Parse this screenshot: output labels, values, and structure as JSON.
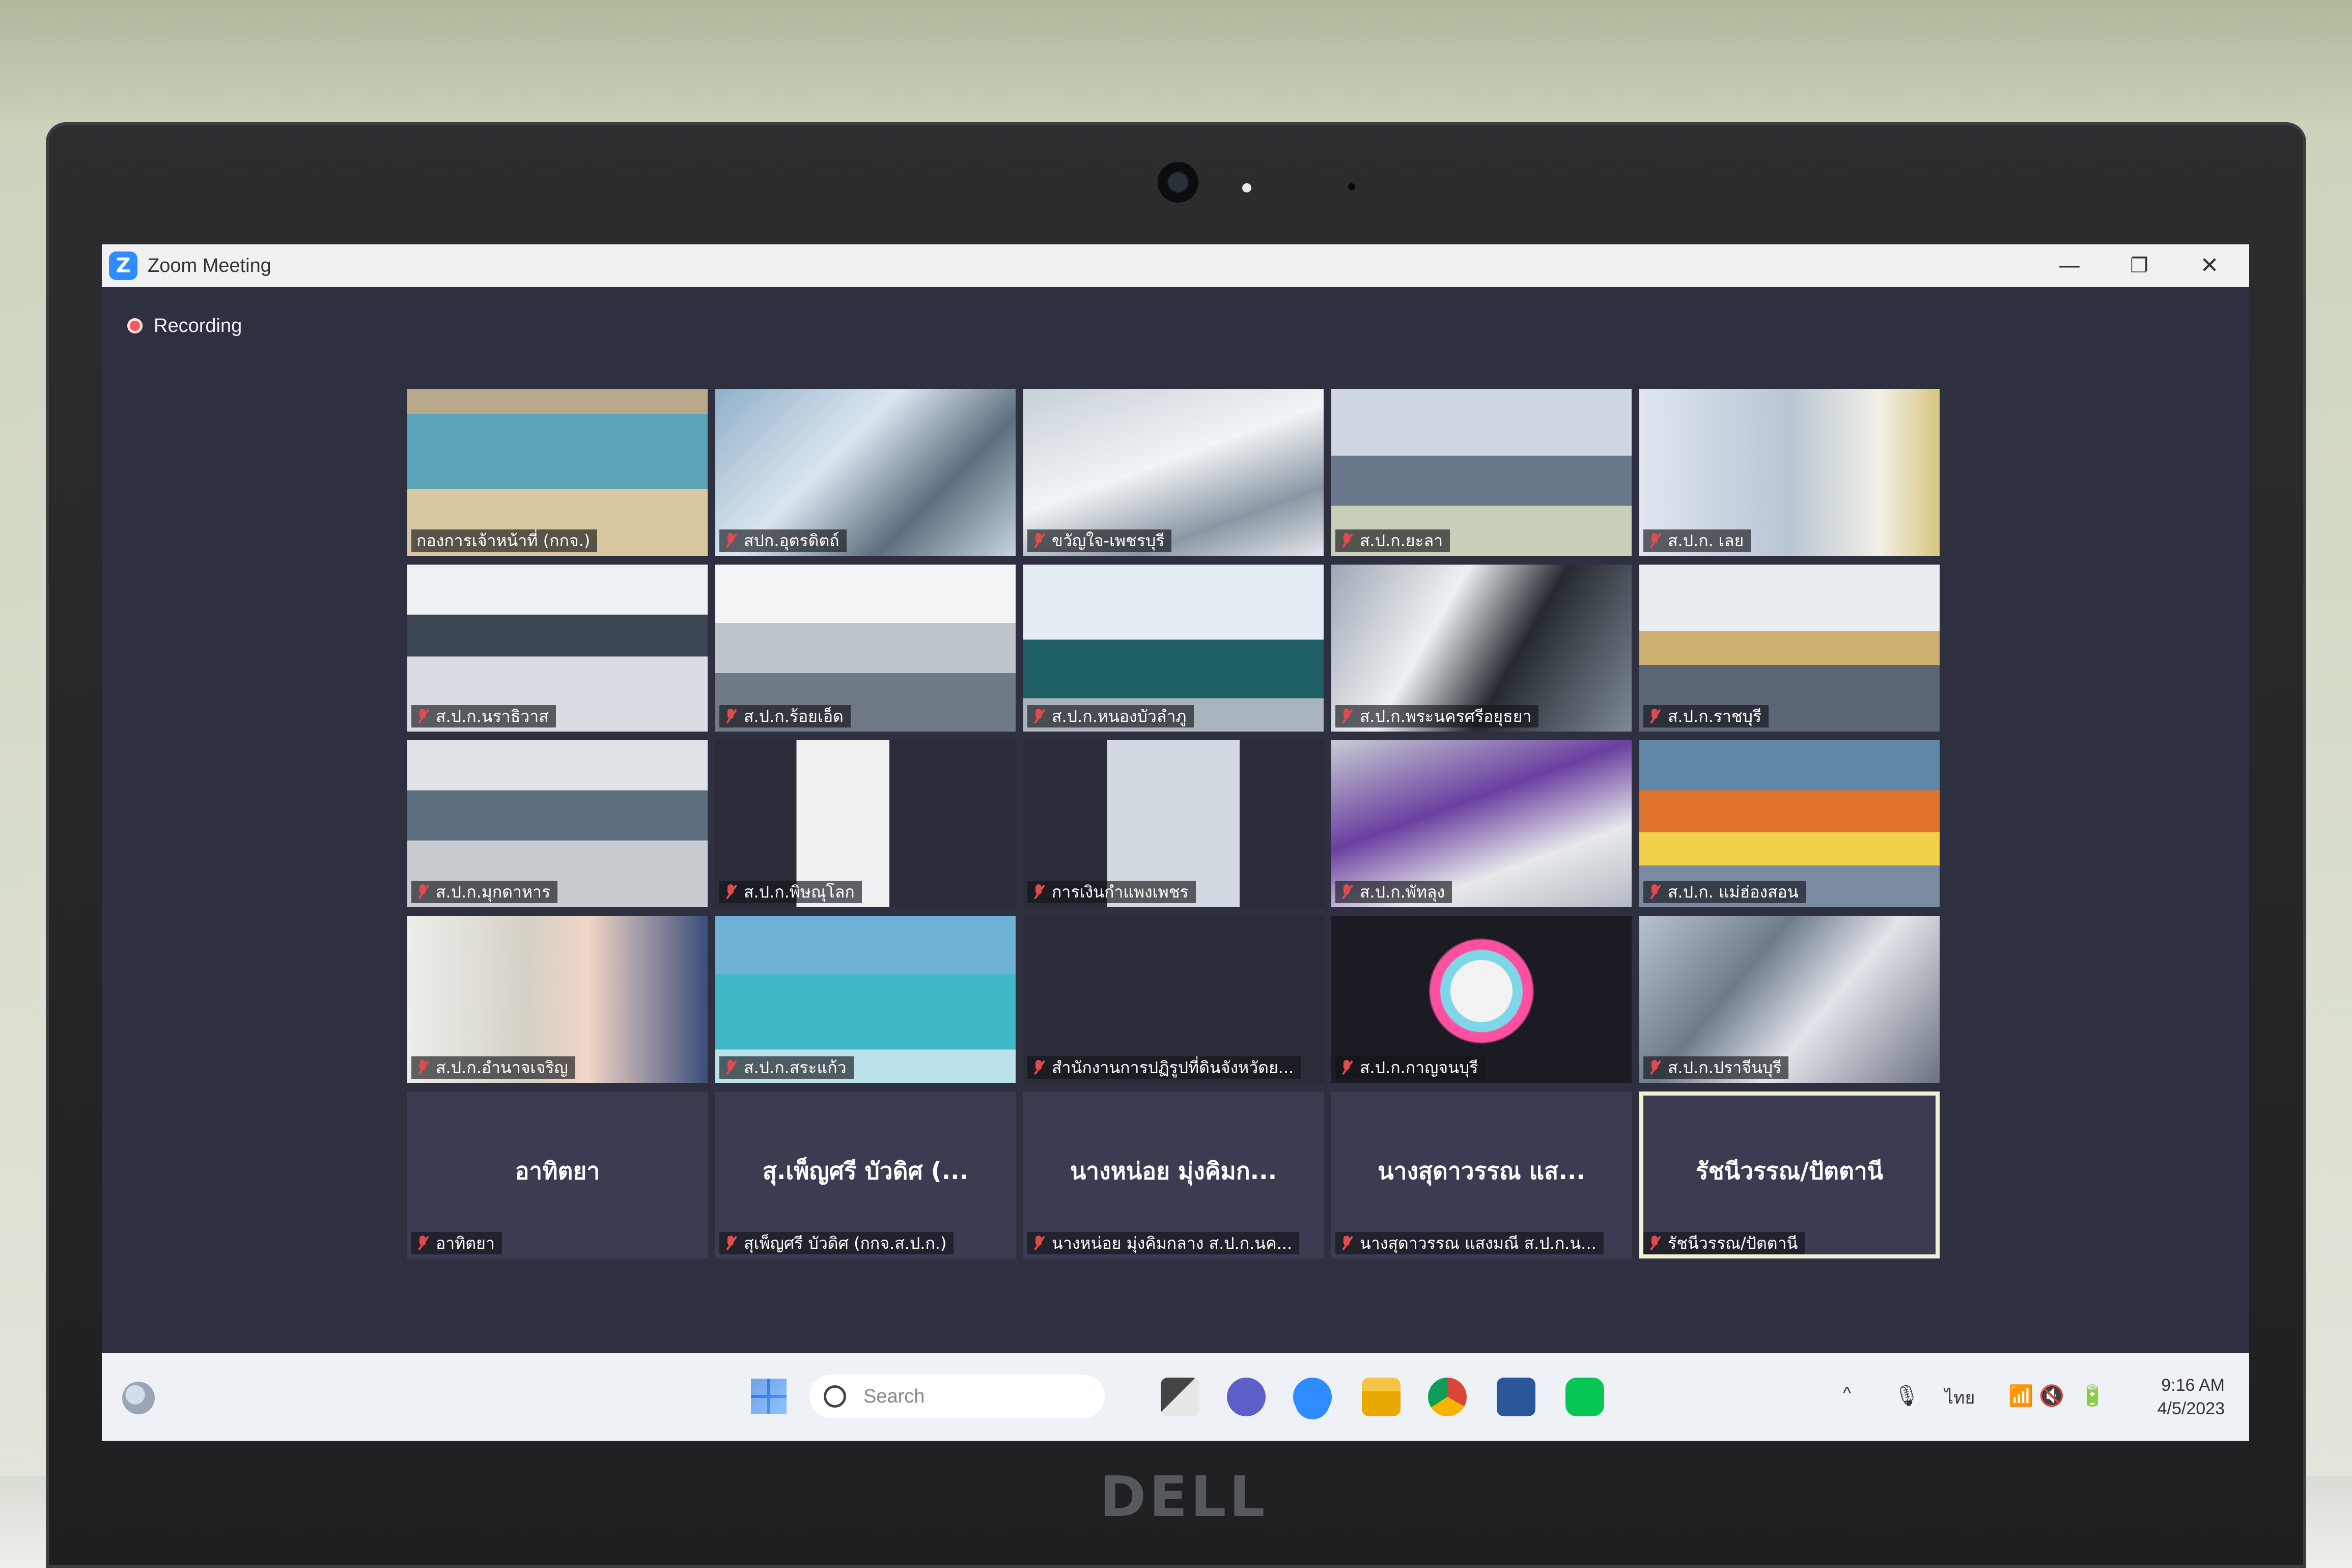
{
  "window": {
    "title": "Zoom Meeting",
    "minimize": "—",
    "restore": "❐",
    "close": "✕"
  },
  "recording": {
    "label": "Recording"
  },
  "tiles": [
    {
      "name": "กองการเจ้าหน้าที่ (กกจ.)",
      "muted": false
    },
    {
      "name": "สปก.อุตรดิตถ์",
      "muted": true
    },
    {
      "name": "ขวัญใจ-เพชรบุรี",
      "muted": true
    },
    {
      "name": "ส.ป.ก.ยะลา",
      "muted": true
    },
    {
      "name": "ส.ป.ก. เลย",
      "muted": true
    },
    {
      "name": "ส.ป.ก.นราธิวาส",
      "muted": true
    },
    {
      "name": "ส.ป.ก.ร้อยเอ็ด",
      "muted": true
    },
    {
      "name": "ส.ป.ก.หนองบัวลำภู",
      "muted": true
    },
    {
      "name": "ส.ป.ก.พระนครศรีอยุธยา",
      "muted": true
    },
    {
      "name": "ส.ป.ก.ราชบุรี",
      "muted": true
    },
    {
      "name": "ส.ป.ก.มุกดาหาร",
      "muted": true
    },
    {
      "name": "ส.ป.ก.พิษณุโลก",
      "muted": true
    },
    {
      "name": "การเงินกำแพงเพชร",
      "muted": true
    },
    {
      "name": "ส.ป.ก.พัทลุง",
      "muted": true
    },
    {
      "name": "ส.ป.ก. แม่ฮ่องสอน",
      "muted": true
    },
    {
      "name": "ส.ป.ก.อำนาจเจริญ",
      "muted": true
    },
    {
      "name": "ส.ป.ก.สระแก้ว",
      "muted": true
    },
    {
      "name": "สำนักงานการปฏิรูปที่ดินจังหวัดย...",
      "muted": true
    },
    {
      "name": "ส.ป.ก.กาญจนบุรี",
      "muted": true
    },
    {
      "name": "ส.ป.ก.ปราจีนบุรี",
      "muted": true
    },
    {
      "name": "อาทิตยา",
      "display": "อาทิตยา",
      "muted": true
    },
    {
      "name": "สุเพ็ญศรี บัวดิศ (กกจ.ส.ป.ก.)",
      "display": "สุ.เพ็ญศรี บัวดิศ (...",
      "muted": true
    },
    {
      "name": "นางหน่อย มุ่งคิมกลาง ส.ป.ก.นค...",
      "display": "นางหน่อย มุ่งคิมก...",
      "muted": true
    },
    {
      "name": "นางสุดาวรรณ แสงมณี ส.ป.ก.น...",
      "display": "นางสุดาวรรณ แส...",
      "muted": true
    },
    {
      "name": "รัชนีวรรณ/ปัตตานี",
      "display": "รัชนีวรรณ/ปัตตานี",
      "muted": true
    }
  ],
  "taskbar": {
    "search_placeholder": "Search",
    "language": "ไทย",
    "time": "9:16 AM",
    "date": "4/5/2023",
    "tray_chevron": "^"
  },
  "device": {
    "brand": "DELL"
  },
  "colors": {
    "meeting_bg": "#2e3040",
    "zoom_blue": "#2d8cff",
    "recording_red": "#f05a5a",
    "muted_red": "#e04c4c"
  }
}
